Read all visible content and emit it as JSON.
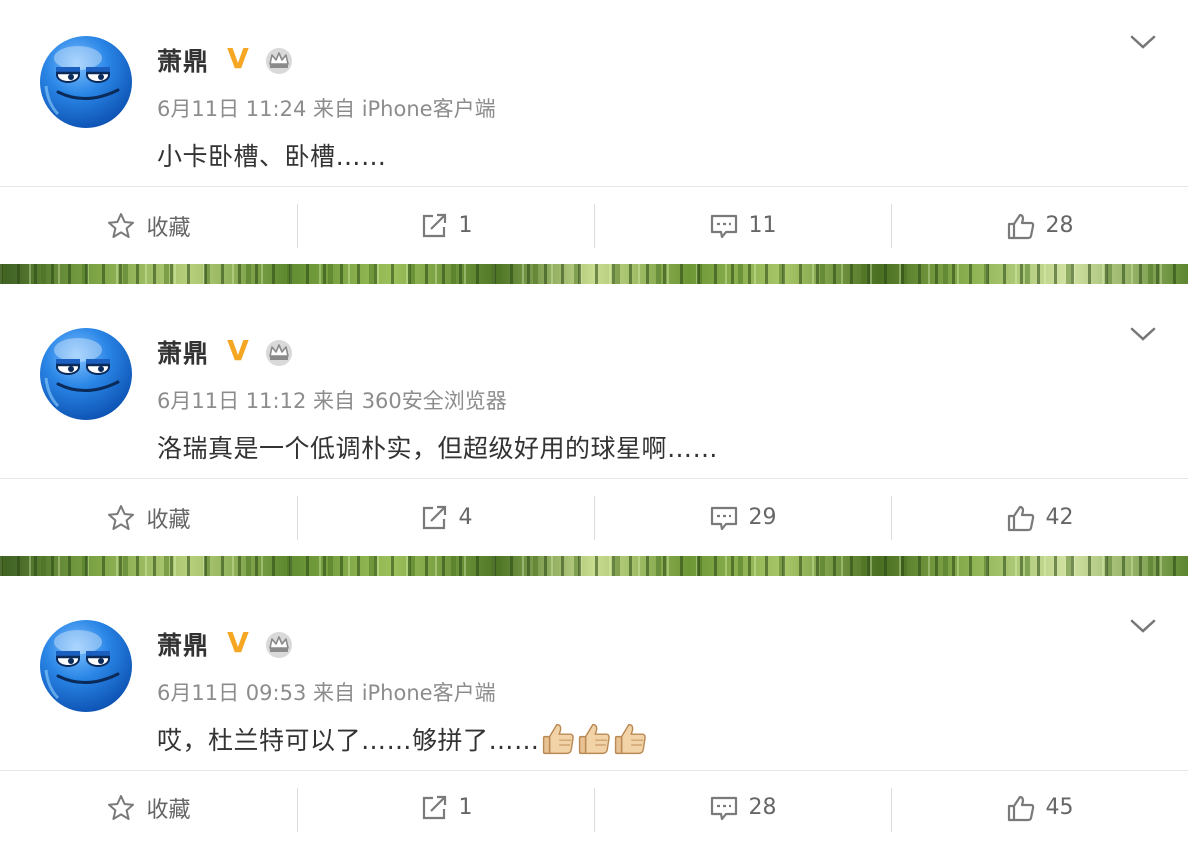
{
  "posts": [
    {
      "author": "萧鼎",
      "date": "6月11日",
      "time": "11:24",
      "source_prefix": "来自",
      "source": "iPhone客户端",
      "text": "小卡卧槽、卧槽……",
      "emojis": [],
      "actions": {
        "favorite_label": "收藏",
        "repost_count": "1",
        "comment_count": "11",
        "like_count": "28"
      }
    },
    {
      "author": "萧鼎",
      "date": "6月11日",
      "time": "11:12",
      "source_prefix": "来自",
      "source": "360安全浏览器",
      "text": "洛瑞真是一个低调朴实，但超级好用的球星啊……",
      "emojis": [],
      "actions": {
        "favorite_label": "收藏",
        "repost_count": "4",
        "comment_count": "29",
        "like_count": "42"
      }
    },
    {
      "author": "萧鼎",
      "date": "6月11日",
      "time": "09:53",
      "source_prefix": "来自",
      "source": "iPhone客户端",
      "text": "哎，杜兰特可以了……够拼了……",
      "emojis": [
        "thumbs-up",
        "thumbs-up",
        "thumbs-up"
      ],
      "actions": {
        "favorite_label": "收藏",
        "repost_count": "1",
        "comment_count": "28",
        "like_count": "45"
      }
    }
  ],
  "badges": {
    "verified": "V"
  },
  "colors": {
    "verified": "#f5a623",
    "text": "#333333",
    "meta": "#8c8c8c",
    "icon": "#7a7a7a",
    "avatar": "#1e74d6"
  },
  "icons": [
    "avatar-smiley",
    "verified-v-icon",
    "vip-crown-icon",
    "chevron-down-icon",
    "star-icon",
    "repost-icon",
    "comment-icon",
    "like-icon"
  ]
}
